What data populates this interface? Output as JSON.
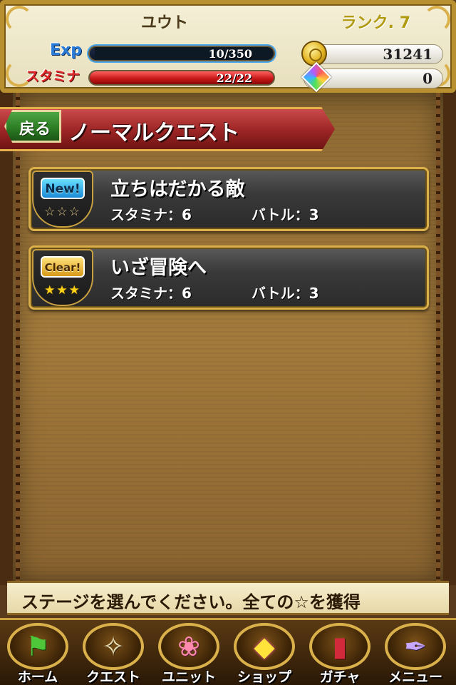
{
  "player": {
    "name": "ユウト",
    "rank_text": "ランク. 7",
    "exp_label": "Exp",
    "exp_text": "10/350",
    "exp_fraction": 0.029,
    "stamina_label": "スタミナ",
    "stamina_text": "22/22",
    "stamina_fraction": 1.0,
    "coins": "31241",
    "gems": "0"
  },
  "nav": {
    "back_label": "戻る",
    "page_title": "ノーマルクエスト"
  },
  "quests": [
    {
      "badge": "New!",
      "stars": "☆☆☆",
      "title": "立ちはだかる敵",
      "stamina": "スタミナ：6",
      "battle": "バトル：3"
    },
    {
      "badge": "Clear!",
      "stars": "★★★",
      "title": "いざ冒険へ",
      "stamina": "スタミナ：6",
      "battle": "バトル：3"
    }
  ],
  "message": "ステージを選んでください。全ての☆を獲得",
  "tabbar": [
    {
      "label": "ホーム",
      "icon": "flag-icon"
    },
    {
      "label": "クエスト",
      "icon": "map-icon"
    },
    {
      "label": "ユニット",
      "icon": "wand-icon"
    },
    {
      "label": "ショップ",
      "icon": "gem-icon"
    },
    {
      "label": "ガチャ",
      "icon": "book-icon"
    },
    {
      "label": "メニュー",
      "icon": "quill-icon"
    }
  ],
  "colors": {
    "stamina_bar": "#c41414",
    "exp_bar_border": "#4aa6e8",
    "frame_gold": "#d9b04a",
    "ribbon_red": "#9c2424",
    "back_green": "#2a7a22"
  }
}
